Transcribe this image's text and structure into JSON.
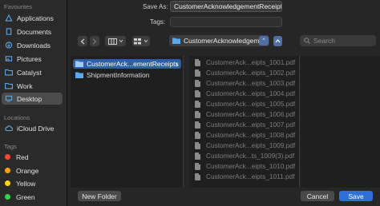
{
  "sidebar": {
    "favourites_heading": "Favourites",
    "favourites": [
      {
        "label": "Applications",
        "icon": "applications-icon"
      },
      {
        "label": "Documents",
        "icon": "document-icon"
      },
      {
        "label": "Downloads",
        "icon": "download-icon"
      },
      {
        "label": "Pictures",
        "icon": "pictures-icon"
      },
      {
        "label": "Catalyst",
        "icon": "folder-icon"
      },
      {
        "label": "Work",
        "icon": "folder-icon"
      },
      {
        "label": "Desktop",
        "icon": "desktop-icon",
        "selected": true
      }
    ],
    "locations_heading": "Locations",
    "locations": [
      {
        "label": "iCloud Drive",
        "icon": "cloud-icon"
      }
    ],
    "tags_heading": "Tags",
    "tags": [
      {
        "label": "Red",
        "color": "#ff453a"
      },
      {
        "label": "Orange",
        "color": "#ff9f0a"
      },
      {
        "label": "Yellow",
        "color": "#ffd60a"
      },
      {
        "label": "Green",
        "color": "#32d74b"
      }
    ]
  },
  "form": {
    "save_as_label": "Save As:",
    "save_as_value": "CustomerAcknowledgementReceipt",
    "tags_label": "Tags:"
  },
  "toolbar": {
    "path_popup_value": "CustomerAcknowledgem...",
    "search_placeholder": "Search"
  },
  "browser": {
    "column1": [
      {
        "label": "CustomerAck...ementReceipts",
        "selected": true,
        "has_children": true
      },
      {
        "label": "ShipmentInformation",
        "selected": false,
        "has_children": false
      }
    ],
    "column2": [
      "CustomerAck...eipts_1001.pdf",
      "CustomerAck...eipts_1002.pdf",
      "CustomerAck...eipts_1003.pdf",
      "CustomerAck...eipts_1004.pdf",
      "CustomerAck...eipts_1005.pdf",
      "CustomerAck...eipts_1006.pdf",
      "CustomerAck...eipts_1007.pdf",
      "CustomerAck...eipts_1008.pdf",
      "CustomerAck...eipts_1009.pdf",
      "CustomerAck...ts_1009(3).pdf",
      "CustomerAck...eipts_1010.pdf",
      "CustomerAck...eipts_1011.pdf"
    ]
  },
  "buttons": {
    "new_folder": "New Folder",
    "cancel": "Cancel",
    "save": "Save"
  },
  "colors": {
    "accent": "#2f6fd8",
    "selection": "#2f5ea8",
    "folder": "#5aa8f0"
  }
}
